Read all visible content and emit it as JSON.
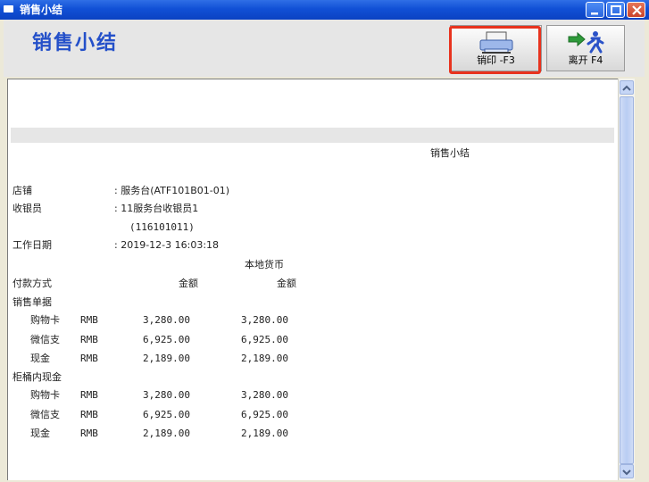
{
  "window": {
    "title": "销售小结"
  },
  "header": {
    "title": "销售小结"
  },
  "toolbar": {
    "print_label": "销印 -F3",
    "exit_label": "离开 F4"
  },
  "report": {
    "title": "销售小结",
    "store_label": "店铺",
    "store_value": ": 服务台(ATF101B01-01)",
    "cashier_label": "收银员",
    "cashier_value": ": 11服务台收银员1",
    "cashier_id": "(116101011)",
    "workday_label": "工作日期",
    "workday_value": ": 2019-12-3 16:03:18",
    "local_currency": "本地货币",
    "col_payment": "付款方式",
    "col_amount": "金额",
    "col_amount_local": "金额",
    "sections": [
      {
        "title": "销售单据",
        "rows": [
          {
            "method": "购物卡",
            "currency": "RMB",
            "amount": "3,280.00",
            "local": "3,280.00"
          },
          {
            "method": "微信支",
            "currency": "RMB",
            "amount": "6,925.00",
            "local": "6,925.00"
          },
          {
            "method": "现金",
            "currency": "RMB",
            "amount": "2,189.00",
            "local": "2,189.00"
          }
        ]
      },
      {
        "title": "柜桶内现金",
        "rows": [
          {
            "method": "购物卡",
            "currency": "RMB",
            "amount": "3,280.00",
            "local": "3,280.00"
          },
          {
            "method": "微信支",
            "currency": "RMB",
            "amount": "6,925.00",
            "local": "6,925.00"
          },
          {
            "method": "现金",
            "currency": "RMB",
            "amount": "2,189.00",
            "local": "2,189.00"
          }
        ]
      }
    ]
  }
}
